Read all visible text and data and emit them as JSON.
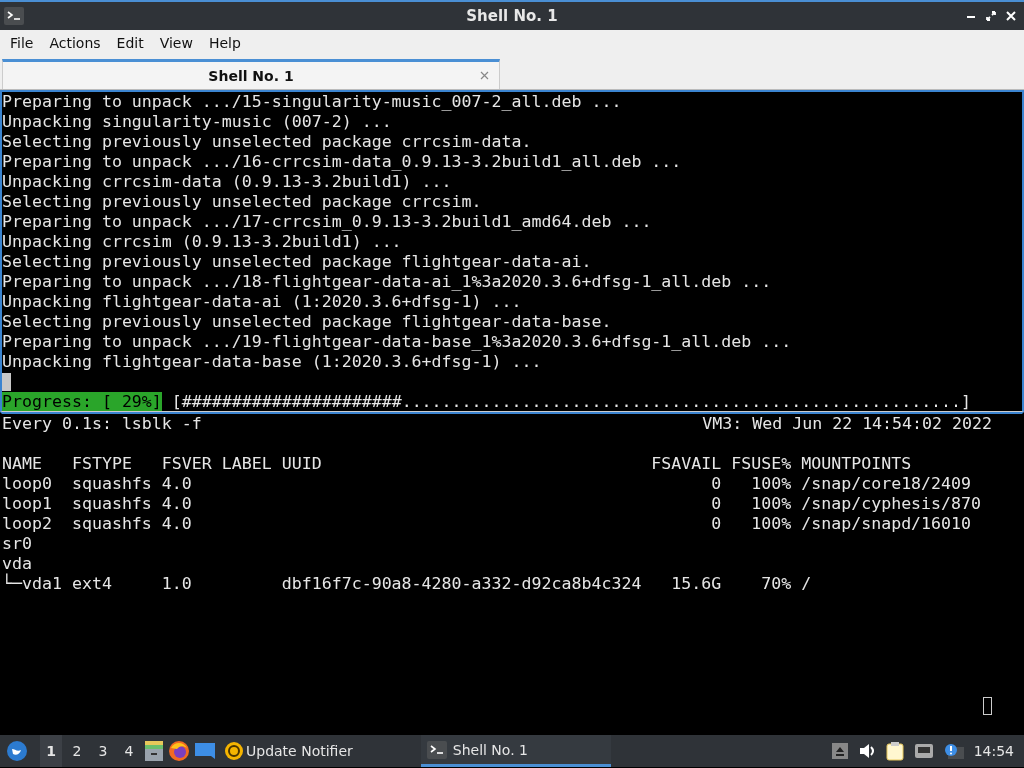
{
  "window": {
    "title": "Shell No. 1"
  },
  "menu": [
    "File",
    "Actions",
    "Edit",
    "View",
    "Help"
  ],
  "tabs": [
    {
      "label": "Shell No. 1",
      "selected": true
    }
  ],
  "top_pane": {
    "focused": true,
    "lines": [
      "Preparing to unpack .../15-singularity-music_007-2_all.deb ...",
      "Unpacking singularity-music (007-2) ...",
      "Selecting previously unselected package crrcsim-data.",
      "Preparing to unpack .../16-crrcsim-data_0.9.13-3.2build1_all.deb ...",
      "Unpacking crrcsim-data (0.9.13-3.2build1) ...",
      "Selecting previously unselected package crrcsim.",
      "Preparing to unpack .../17-crrcsim_0.9.13-3.2build1_amd64.deb ...",
      "Unpacking crrcsim (0.9.13-3.2build1) ...",
      "Selecting previously unselected package flightgear-data-ai.",
      "Preparing to unpack .../18-flightgear-data-ai_1%3a2020.3.6+dfsg-1_all.deb ...",
      "Unpacking flightgear-data-ai (1:2020.3.6+dfsg-1) ...",
      "Selecting previously unselected package flightgear-data-base.",
      "Preparing to unpack .../19-flightgear-data-base_1%3a2020.3.6+dfsg-1_all.deb ...",
      "Unpacking flightgear-data-base (1:2020.3.6+dfsg-1) ..."
    ],
    "progress_label": "Progress: [ 29%]",
    "progress_bar": "[######################........................................................]"
  },
  "bottom_pane": {
    "focused": false,
    "command": "Every 0.1s: lsblk -f",
    "host_time": "VM3: Wed Jun 22 14:54:02 2022",
    "lines": [
      "NAME   FSTYPE   FSVER LABEL UUID                                 FSAVAIL FSUSE% MOUNTPOINTS",
      "loop0  squashfs 4.0                                                    0   100% /snap/core18/2409",
      "loop1  squashfs 4.0                                                    0   100% /snap/cyphesis/870",
      "loop2  squashfs 4.0                                                    0   100% /snap/snapd/16010",
      "sr0",
      "vda",
      "└─vda1 ext4     1.0         dbf16f7c-90a8-4280-a332-d92ca8b4c324   15.6G    70% /"
    ]
  },
  "taskbar": {
    "workspaces": [
      {
        "label": "1",
        "selected": true
      },
      {
        "label": "2",
        "selected": false
      },
      {
        "label": "3",
        "selected": false
      },
      {
        "label": "4",
        "selected": false
      }
    ],
    "apps": [
      {
        "label": "Update Notifier"
      }
    ],
    "tasks": [
      {
        "label": "Shell No. 1",
        "selected": true
      }
    ],
    "clock": "14:54"
  }
}
